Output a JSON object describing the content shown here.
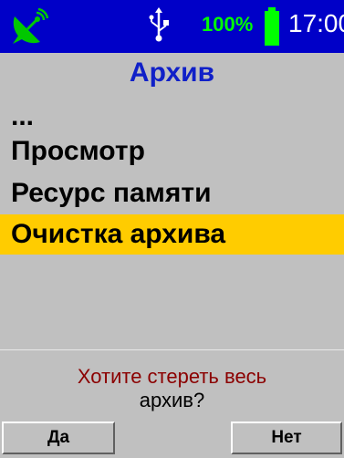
{
  "status_bar": {
    "battery_percent": "100%",
    "time": "17:00",
    "colors": {
      "background": "#0000c8",
      "battery": "#00ff00",
      "satellite": "#00c800"
    },
    "icons": [
      "satellite-dish-icon",
      "usb-icon",
      "battery-icon"
    ]
  },
  "title": "Архив",
  "menu": {
    "items": [
      {
        "label": "...",
        "selected": false
      },
      {
        "label": "Просмотр",
        "selected": false
      },
      {
        "label": "Ресурс памяти",
        "selected": false
      },
      {
        "label": "Очистка архива",
        "selected": true
      }
    ],
    "highlight_color": "#ffcc00"
  },
  "dialog": {
    "line1": "Хотите стереть весь",
    "line2": "архив?",
    "yes_label": "Да",
    "no_label": "Нет",
    "line1_color": "#8b0000"
  }
}
